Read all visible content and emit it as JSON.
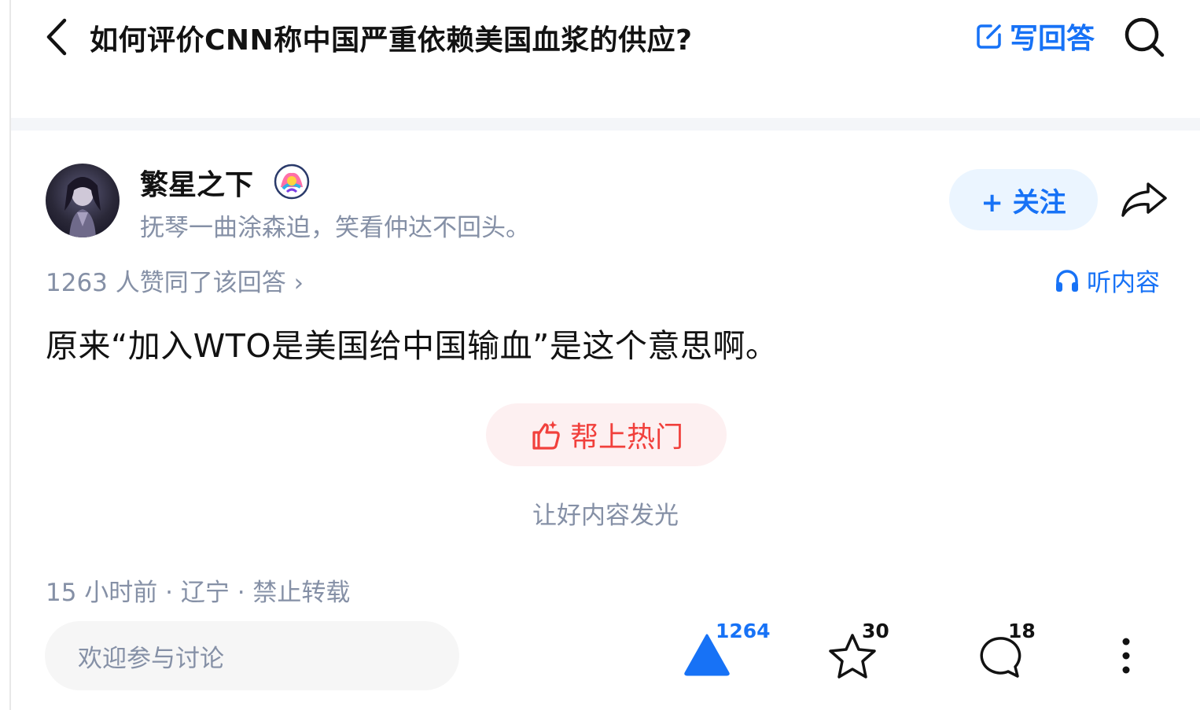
{
  "header": {
    "question_title": "如何评价CNN称中国严重依赖美国血浆的供应?",
    "write_answer_label": "写回答",
    "icons": [
      "back-icon",
      "edit-icon",
      "search-icon"
    ]
  },
  "author": {
    "name": "繁星之下",
    "bio": "抚琴一曲涂森迫，笑看仲达不回头。",
    "follow_label": "+ 关注"
  },
  "answer": {
    "votes_summary": "1263 人赞同了该回答 ›",
    "listen_label": "听内容",
    "text": "原来“加入WTO是美国给中国输血”是这个意思啊。",
    "hot_button_label": "帮上热门",
    "hot_caption": "让好内容发光",
    "meta": "15 小时前 · 辽宁 · 禁止转载"
  },
  "bottom_bar": {
    "comment_placeholder": "欢迎参与讨论",
    "upvote_count": "1264",
    "favorite_count": "30",
    "comment_count": "18"
  },
  "colors": {
    "accent_blue": "#1772f6",
    "hot_red": "#f1403c",
    "muted_text": "#8590a6",
    "primary_text": "#121212"
  }
}
